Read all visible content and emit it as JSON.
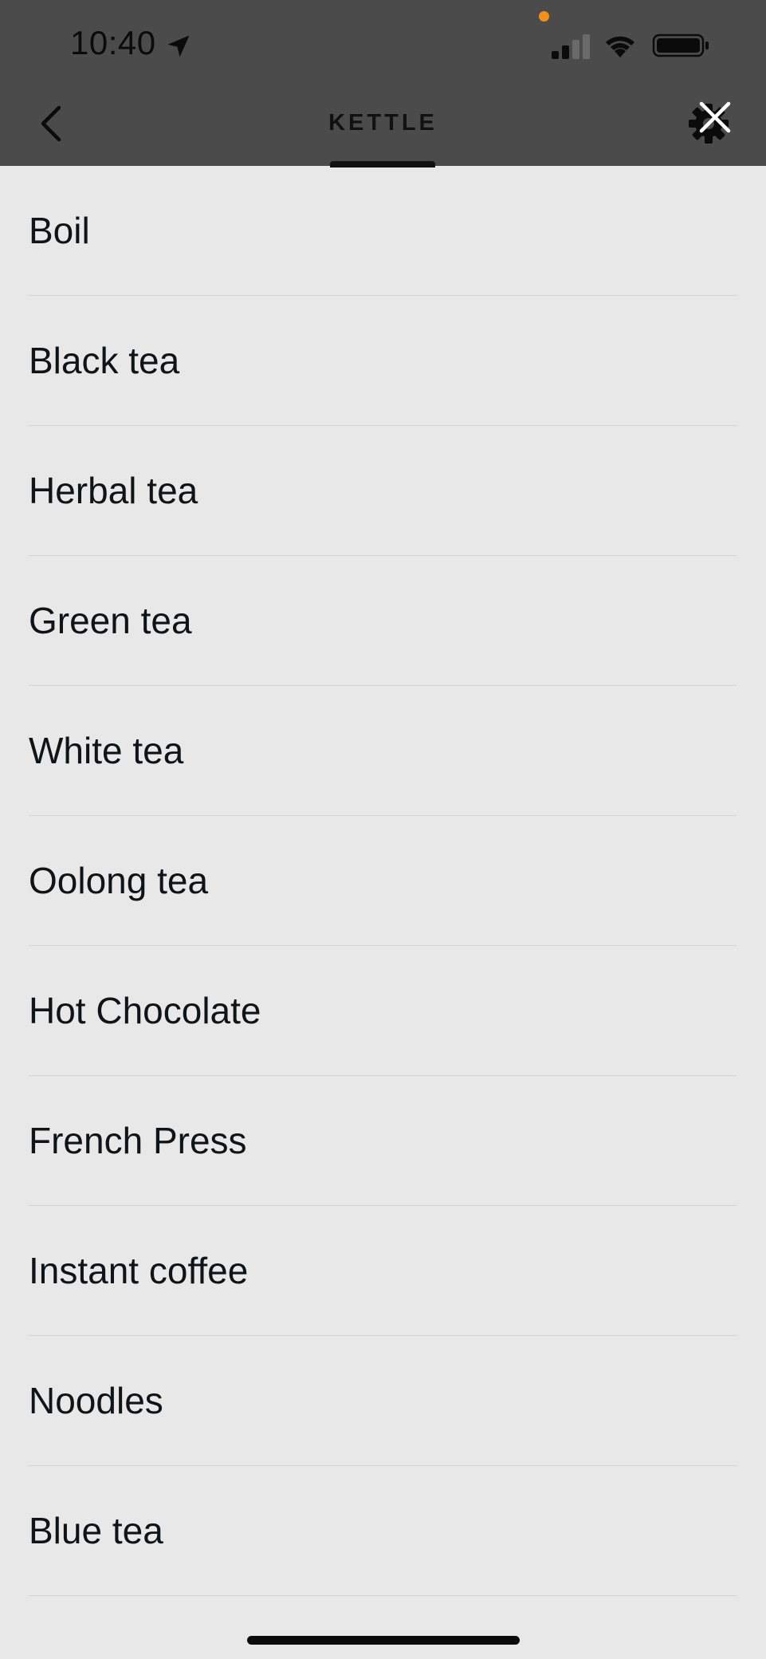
{
  "status_bar": {
    "time": "10:40",
    "icons": [
      "location-arrow-icon",
      "signal-icon",
      "wifi-icon",
      "battery-icon"
    ],
    "indicator_color": "#f0911b"
  },
  "nav": {
    "title": "KETTLE",
    "back_icon": "chevron-left-icon",
    "settings_icon": "gear-icon",
    "close_icon": "close-icon"
  },
  "presets": [
    {
      "label": "Boil"
    },
    {
      "label": "Black tea"
    },
    {
      "label": "Herbal tea"
    },
    {
      "label": "Green tea"
    },
    {
      "label": "White tea"
    },
    {
      "label": "Oolong tea"
    },
    {
      "label": "Hot Chocolate"
    },
    {
      "label": "French Press"
    },
    {
      "label": "Instant coffee"
    },
    {
      "label": "Noodles"
    },
    {
      "label": "Blue tea"
    }
  ],
  "colors": {
    "header_background": "#4b4b4b",
    "list_background": "#e8e8e8",
    "divider": "#d3d3d3"
  }
}
